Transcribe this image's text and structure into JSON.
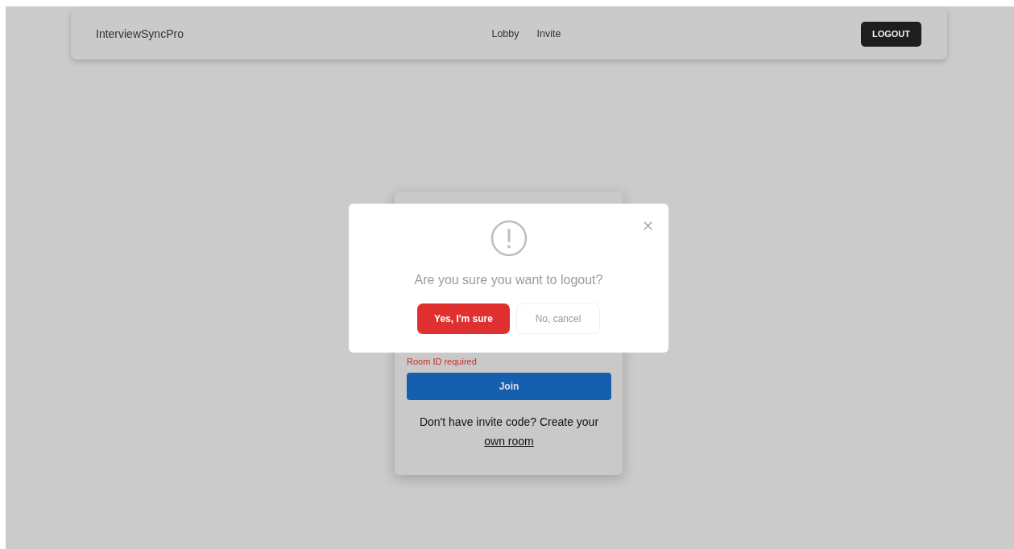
{
  "navbar": {
    "brand": "InterviewSyncPro",
    "links": [
      "Lobby",
      "Invite"
    ],
    "logout_button": "LOGOUT"
  },
  "join_card": {
    "error": "Room ID required",
    "join_button": "Join",
    "prompt": "Don't have invite code? Create your",
    "link": "own room"
  },
  "dialog": {
    "close": "×",
    "message": "Are you sure you want to logout?",
    "confirm_button": "Yes, I'm sure",
    "cancel_button": "No, cancel"
  }
}
